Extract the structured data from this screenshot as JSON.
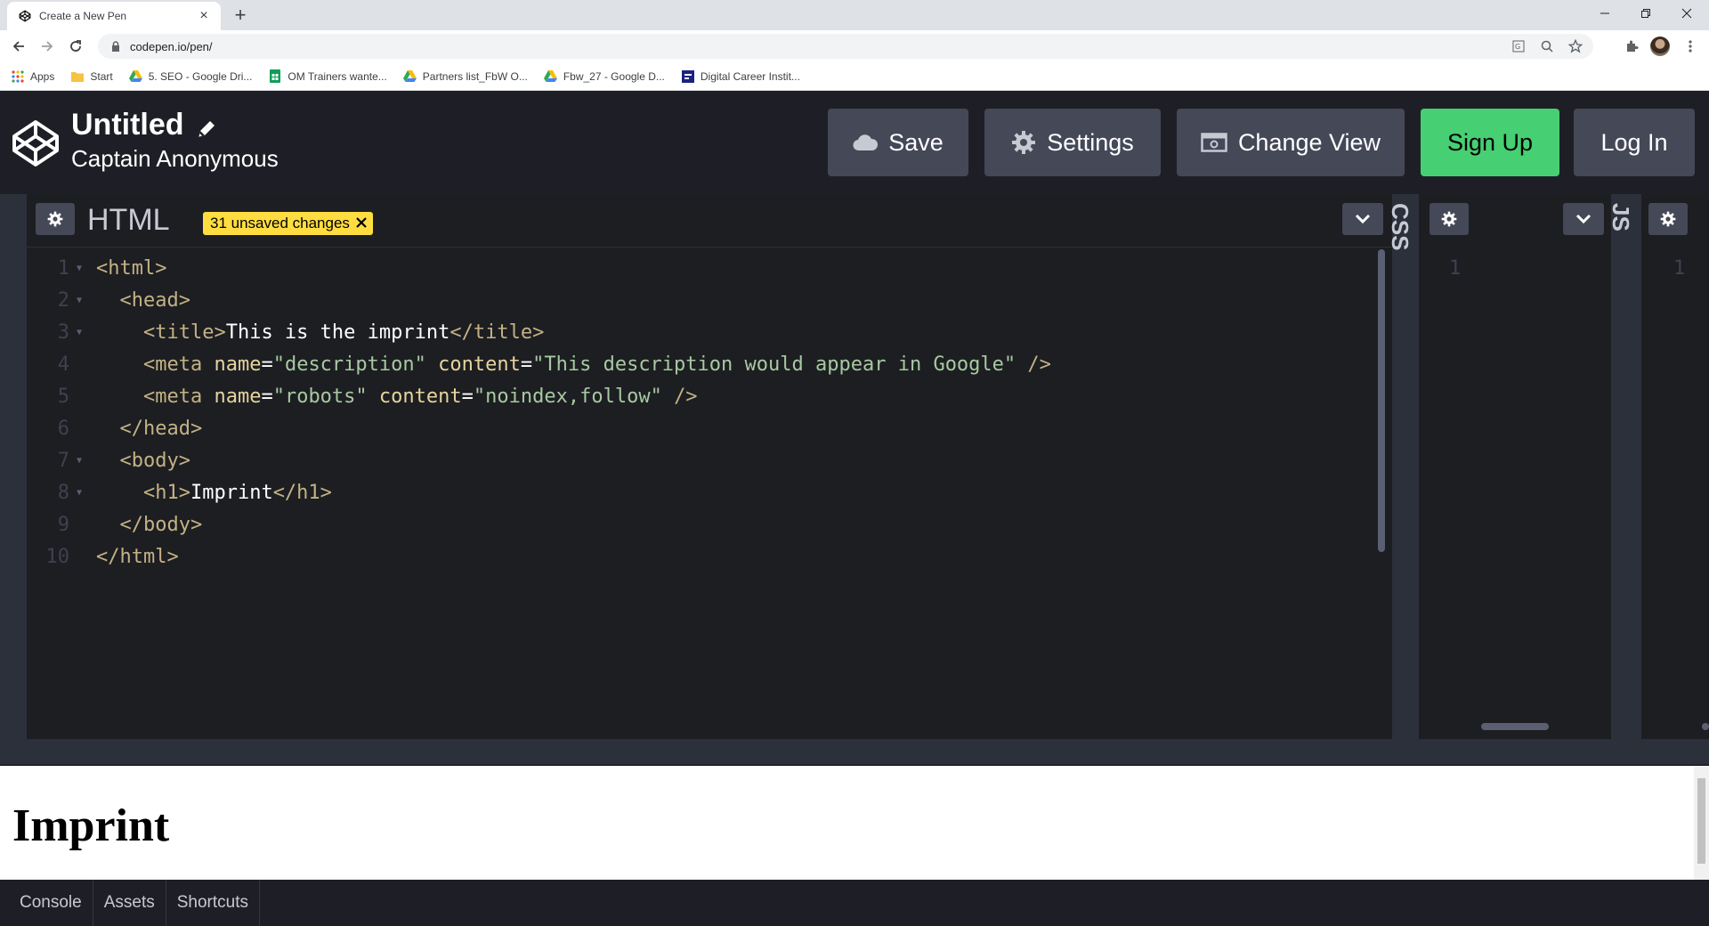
{
  "browser": {
    "tab_title": "Create a New Pen",
    "tab_close": "×",
    "new_tab": "+",
    "url": "codepen.io/pen/",
    "bookmarks": [
      {
        "label": "Apps",
        "icon": "apps-grid-icon"
      },
      {
        "label": "Start",
        "icon": "folder-icon"
      },
      {
        "label": "5. SEO - Google Dri...",
        "icon": "google-drive-icon"
      },
      {
        "label": "OM Trainers wante...",
        "icon": "sheets-icon"
      },
      {
        "label": "Partners list_FbW O...",
        "icon": "google-drive-icon"
      },
      {
        "label": "Fbw_27 - Google D...",
        "icon": "google-drive-icon"
      },
      {
        "label": "Digital Career Instit...",
        "icon": "site-icon"
      }
    ]
  },
  "header": {
    "title": "Untitled",
    "author": "Captain Anonymous",
    "buttons": {
      "save": "Save",
      "settings": "Settings",
      "change_view": "Change View",
      "signup": "Sign Up",
      "login": "Log In"
    }
  },
  "editor": {
    "html_label": "HTML",
    "unsaved_badge": "31 unsaved changes",
    "css_label": "CSS",
    "js_label": "JS",
    "css_line": "1",
    "js_line": "1",
    "lines": [
      "1",
      "2",
      "3",
      "4",
      "5",
      "6",
      "7",
      "8",
      "9",
      "10"
    ]
  },
  "preview": {
    "heading": "Imprint"
  },
  "bottom": {
    "console": "Console",
    "assets": "Assets",
    "shortcuts": "Shortcuts"
  },
  "colors": {
    "accent_green": "#47cf73",
    "badge_yellow": "#ffdd40",
    "header_bg": "#1e1f26"
  }
}
